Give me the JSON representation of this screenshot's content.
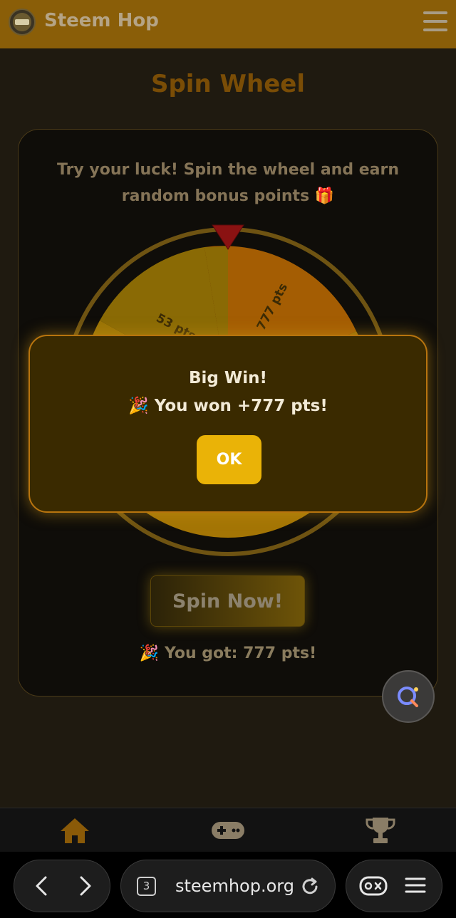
{
  "header": {
    "app_title": "Steem Hop",
    "logo_text": "STEEM HOP",
    "menu_icon": "hamburger-icon"
  },
  "page": {
    "heading": "Spin Wheel",
    "tagline_line1": "Try your luck! Spin the wheel and earn",
    "tagline_line2": "random bonus points 🎁",
    "wheel_labels": [
      "53 pts",
      "777 pts"
    ],
    "spin_button": "Spin Now!",
    "result": "🎉 You got: 777 pts!"
  },
  "modal": {
    "title": "Big Win!",
    "message": "🎉 You won +777 pts!",
    "ok_label": "OK"
  },
  "tabbar": {
    "icons": [
      "home-icon",
      "gamepad-icon",
      "trophy-icon"
    ]
  },
  "browser": {
    "tab_count": "3",
    "url": "steemhop.org"
  },
  "colors": {
    "header_bg": "#8a5e08",
    "accent_yellow": "#eab307",
    "modal_border": "#b8740e",
    "page_bg": "#1f1a10"
  }
}
